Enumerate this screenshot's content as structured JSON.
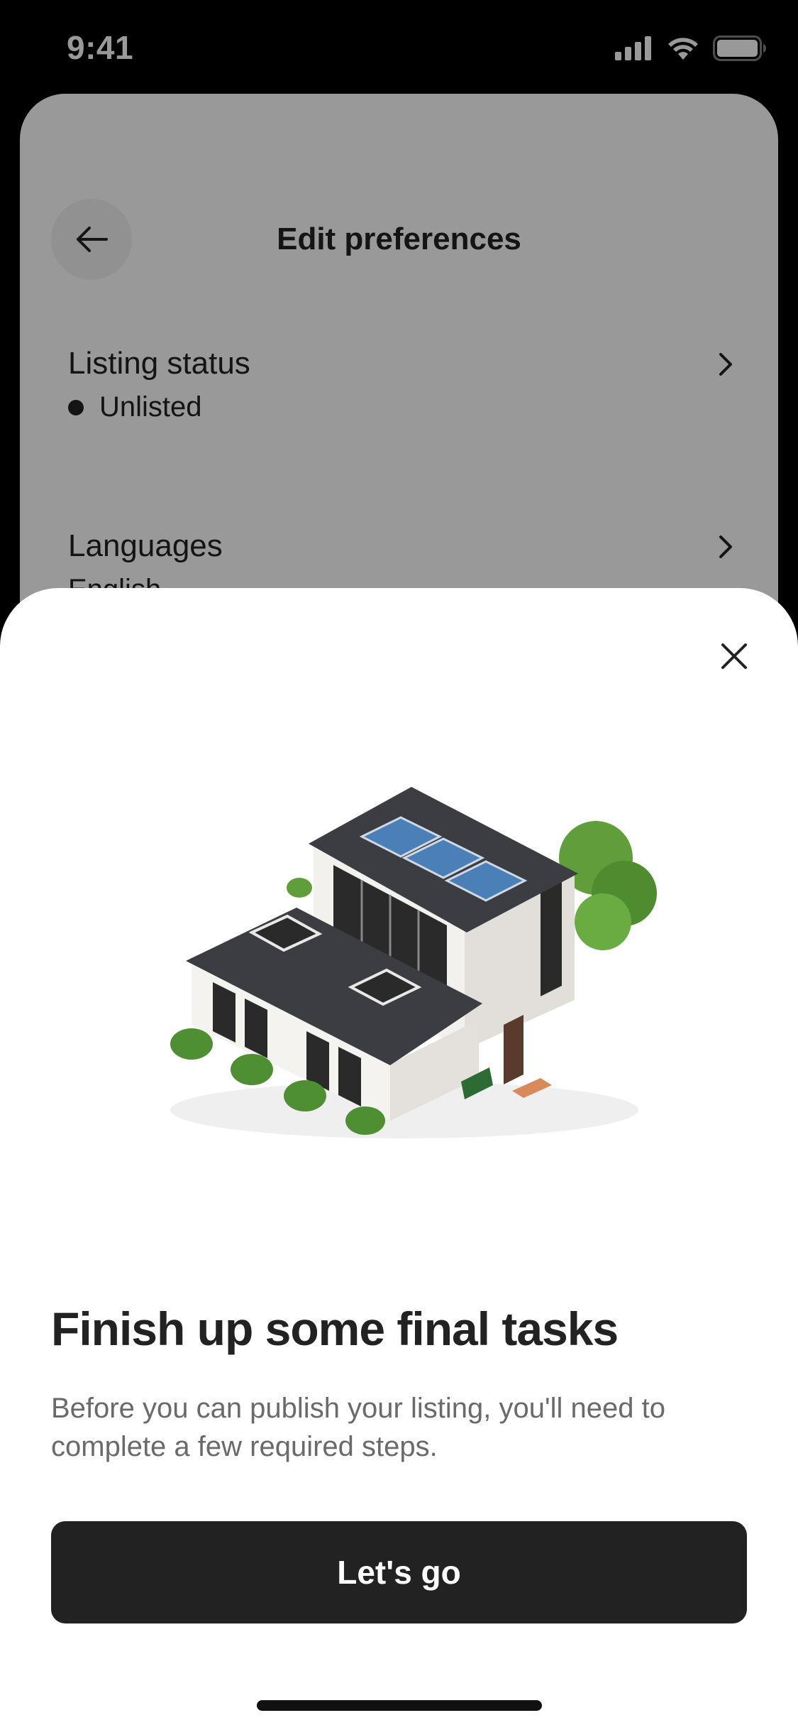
{
  "status_bar": {
    "time": "9:41",
    "icons": [
      "cellular-signal-icon",
      "wifi-icon",
      "battery-icon"
    ]
  },
  "background_screen": {
    "title": "Edit preferences",
    "back_icon": "arrow-left-icon",
    "rows": [
      {
        "label": "Listing status",
        "value": "Unlisted",
        "status_dot": true
      },
      {
        "label": "Languages",
        "value": "English"
      }
    ]
  },
  "modal": {
    "close_icon": "close-icon",
    "illustration": "modern-house-illustration",
    "title": "Finish up some final tasks",
    "description": "Before you can publish your listing, you'll need to complete a few required steps.",
    "cta_label": "Let's go"
  },
  "colors": {
    "primary_text": "#222222",
    "secondary_text": "#6a6a6a",
    "button_bg": "#222222",
    "overlay": "rgba(0,0,0,0.4)"
  }
}
